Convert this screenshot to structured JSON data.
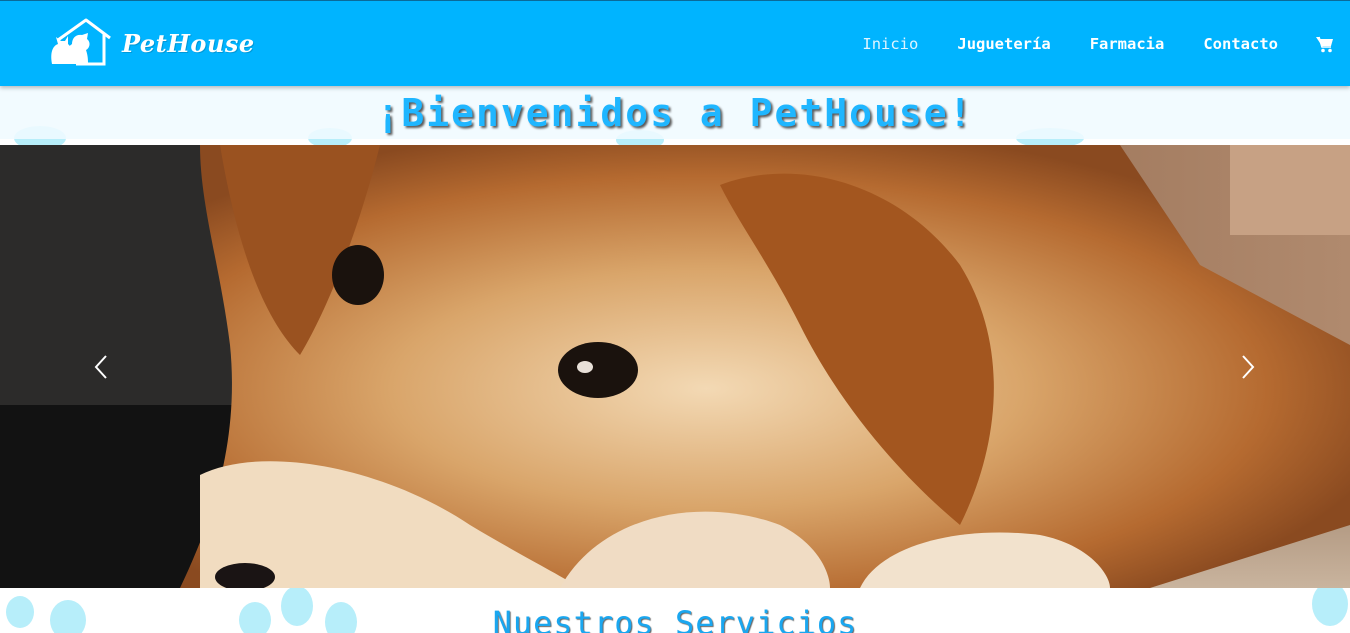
{
  "navbar": {
    "brand": "PetHouse",
    "links": [
      {
        "label": "Inicio",
        "active": true
      },
      {
        "label": "Juguetería",
        "active": false
      },
      {
        "label": "Farmacia",
        "active": false
      },
      {
        "label": "Contacto",
        "active": false
      }
    ],
    "cart_icon": "shopping-cart-icon",
    "color": "#00b4ff"
  },
  "welcome": {
    "title": "¡Bienvenidos a PetHouse!"
  },
  "carousel": {
    "image": "golden-retriever-lying-down",
    "prev_icon": "chevron-left-icon",
    "next_icon": "chevron-right-icon"
  },
  "services": {
    "title": "Nuestros Servicios"
  },
  "colors": {
    "accent": "#00b4ff",
    "paw": "#b3ecfa",
    "title": "#1fb6ff"
  }
}
